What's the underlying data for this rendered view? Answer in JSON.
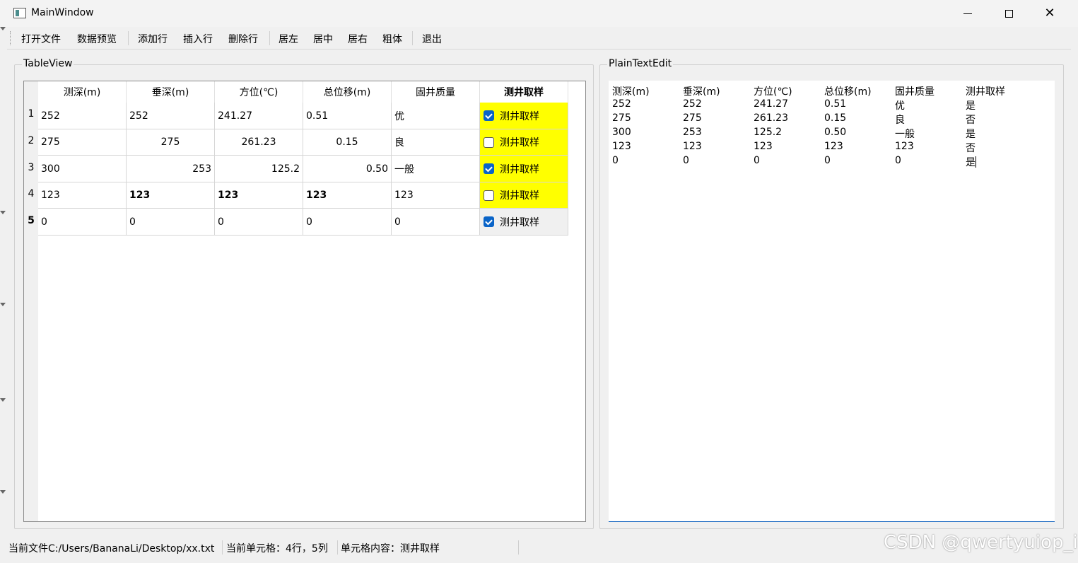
{
  "window": {
    "title": "MainWindow"
  },
  "toolbar": {
    "open_file": "打开文件",
    "preview": "数据预览",
    "add_row": "添加行",
    "insert_row": "插入行",
    "delete_row": "删除行",
    "align_left": "居左",
    "align_center": "居中",
    "align_right": "居右",
    "bold": "粗体",
    "exit": "退出"
  },
  "tableview": {
    "group_title": "TableView",
    "headers": [
      "测深(m)",
      "垂深(m)",
      "方位(℃)",
      "总位移(m)",
      "固井质量",
      "测井取样"
    ],
    "row_labels": [
      "1",
      "2",
      "3",
      "4",
      "5"
    ],
    "rows": [
      {
        "c0": "252",
        "c1": "252",
        "c2": "241.27",
        "c3": "0.51",
        "c4": "优",
        "c5": "测井取样",
        "checked": true
      },
      {
        "c0": "275",
        "c1": "275",
        "c2": "261.23",
        "c3": "0.15",
        "c4": "良",
        "c5": "测井取样",
        "checked": false
      },
      {
        "c0": "300",
        "c1": "253",
        "c2": "125.2",
        "c3": "0.50",
        "c4": "一般",
        "c5": "测井取样",
        "checked": true
      },
      {
        "c0": "123",
        "c1": "123",
        "c2": "123",
        "c3": "123",
        "c4": "123",
        "c5": "测井取样",
        "checked": false
      },
      {
        "c0": "0",
        "c1": "0",
        "c2": "0",
        "c3": "0",
        "c4": "0",
        "c5": "测井取样",
        "checked": true
      }
    ],
    "highlight_color": "#ffff00",
    "current_row_label": "5",
    "current_header": "测井取样"
  },
  "plaintext": {
    "group_title": "PlainTextEdit",
    "lines": [
      [
        "测深(m)",
        "垂深(m)",
        "方位(℃)",
        "总位移(m)",
        "固井质量",
        "测井取样"
      ],
      [
        "252",
        "252",
        "241.27",
        "0.51",
        "优",
        "是"
      ],
      [
        "275",
        "275",
        "261.23",
        "0.15",
        "良",
        "否"
      ],
      [
        "300",
        "253",
        "125.2",
        "0.50",
        "一般",
        "是"
      ],
      [
        "123",
        "123",
        "123",
        "123",
        "123",
        "否"
      ],
      [
        "0",
        "0",
        "0",
        "0",
        "0",
        "是"
      ]
    ]
  },
  "statusbar": {
    "current_file": "当前文件C:/Users/BananaLi/Desktop/xx.txt",
    "current_cell": "当前单元格：4行，5列",
    "cell_content": "单元格内容：测井取样"
  },
  "watermark": "CSDN @qwertyuiop_i"
}
